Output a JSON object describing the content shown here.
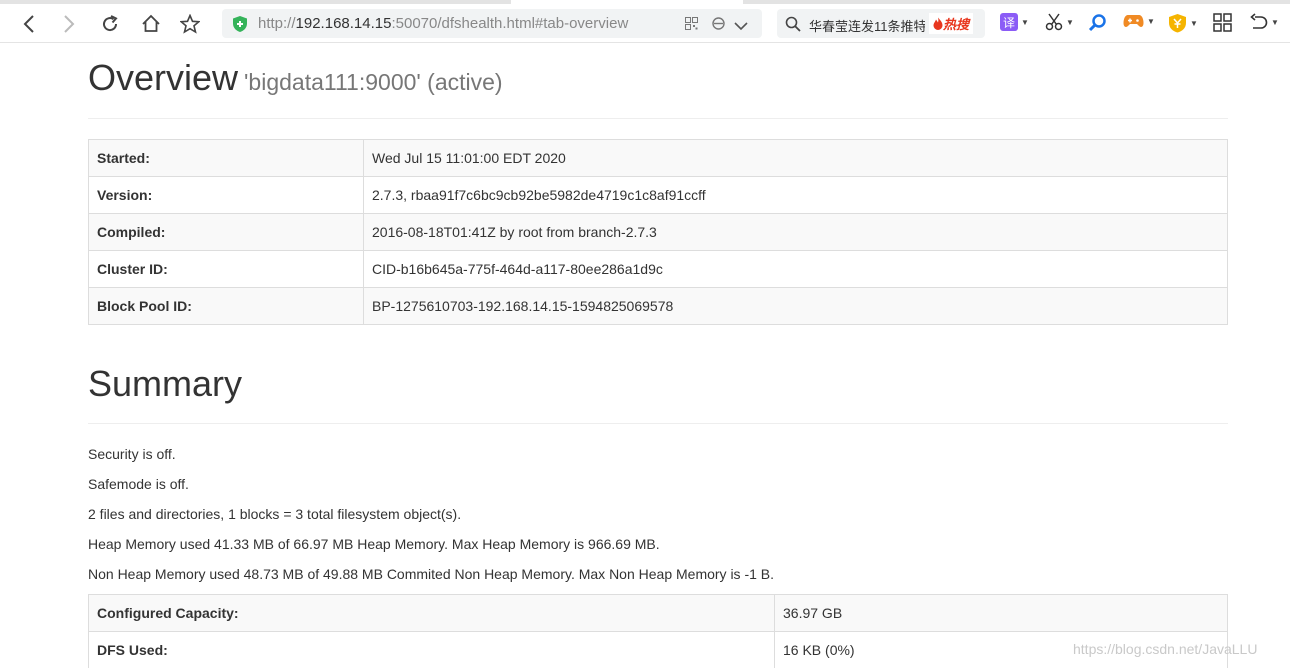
{
  "browser": {
    "url_prefix": "http://",
    "url_host": "192.168.14.15",
    "url_rest": ":50070/dfshealth.html#tab-overview",
    "search_text": "华春莹连发11条推特",
    "hot_label": "热搜",
    "translate_label": "译",
    "accent_green": "#35b35a",
    "accent_red": "#e8361e"
  },
  "overview": {
    "title": "Overview",
    "subtitle": "'bigdata111:9000' (active)",
    "rows": [
      {
        "key": "Started:",
        "value": "Wed Jul 15 11:01:00 EDT 2020"
      },
      {
        "key": "Version:",
        "value": "2.7.3, rbaa91f7c6bc9cb92be5982de4719c1c8af91ccff"
      },
      {
        "key": "Compiled:",
        "value": "2016-08-18T01:41Z by root from branch-2.7.3"
      },
      {
        "key": "Cluster ID:",
        "value": "CID-b16b645a-775f-464d-a117-80ee286a1d9c"
      },
      {
        "key": "Block Pool ID:",
        "value": "BP-1275610703-192.168.14.15-1594825069578"
      }
    ]
  },
  "summary": {
    "title": "Summary",
    "lines": [
      "Security is off.",
      "Safemode is off.",
      "2 files and directories, 1 blocks = 3 total filesystem object(s).",
      "Heap Memory used 41.33 MB of 66.97 MB Heap Memory. Max Heap Memory is 966.69 MB.",
      "Non Heap Memory used 48.73 MB of 49.88 MB Commited Non Heap Memory. Max Non Heap Memory is -1 B."
    ],
    "rows": [
      {
        "key": "Configured Capacity:",
        "value": "36.97 GB"
      },
      {
        "key": "DFS Used:",
        "value": "16 KB (0%)"
      }
    ]
  },
  "watermark": "https://blog.csdn.net/JavaLLU"
}
